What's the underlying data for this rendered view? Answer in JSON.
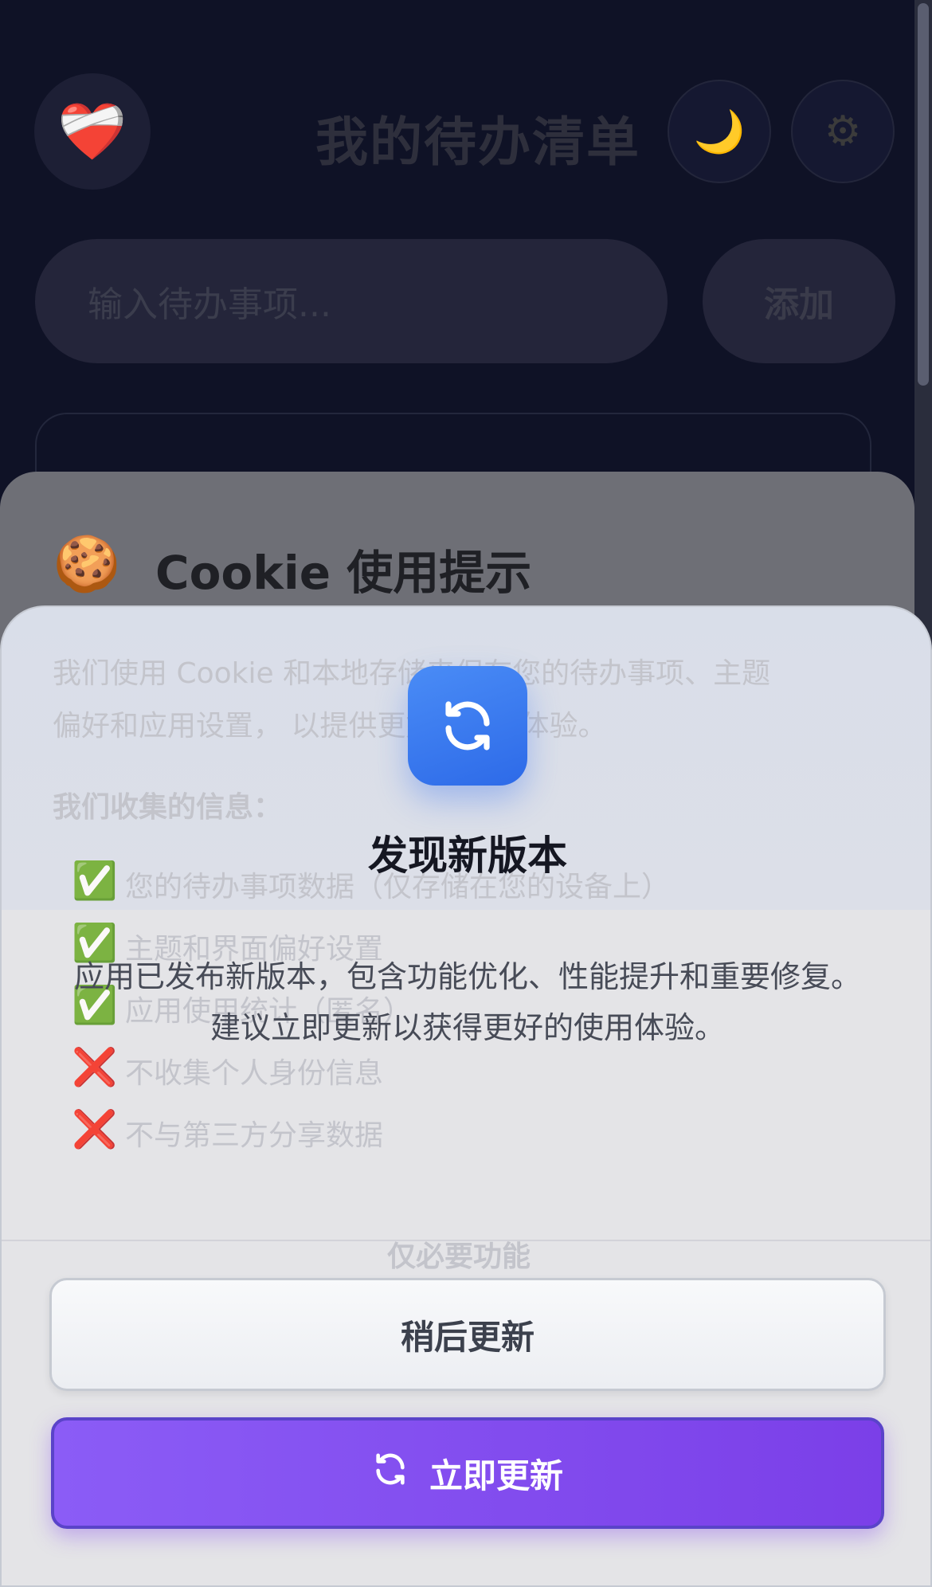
{
  "app": {
    "avatar_emoji": "❤️‍🩹",
    "title": "我的待办清单",
    "theme_toggle_icon": "🌙",
    "settings_icon": "⚙",
    "input_placeholder": "输入待办事项...",
    "add_button_label": "添加"
  },
  "cookie_notice": {
    "icon": "🍪",
    "title": "Cookie 使用提示",
    "intro_line1": "我们使用 Cookie 和本地存储来保存您的待办事项、主题",
    "intro_line2": "偏好和应用设置，  以提供更好的用户体验。",
    "collected_heading": "我们收集的信息：",
    "items": [
      {
        "mark": "✅",
        "text": "您的待办事项数据（仅存储在您的设备上）"
      },
      {
        "mark": "✅",
        "text": "主题和界面偏好设置"
      },
      {
        "mark": "✅",
        "text": "应用使用统计（匿名）"
      },
      {
        "mark": "❌",
        "text": "不收集个人身份信息"
      },
      {
        "mark": "❌",
        "text": "不与第三方分享数据"
      }
    ],
    "essential_only_label": "仅必要功能"
  },
  "update_dialog": {
    "icon": "refresh-icon",
    "title": "发现新版本",
    "message": "应用已发布新版本，包含功能优化、性能提升和重要修复。建议立即更新以获得更好的使用体验。",
    "later_button_label": "稍后更新",
    "update_button_label": "立即更新",
    "accent_color": "#7c3aed",
    "icon_color": "#3b82f6"
  }
}
